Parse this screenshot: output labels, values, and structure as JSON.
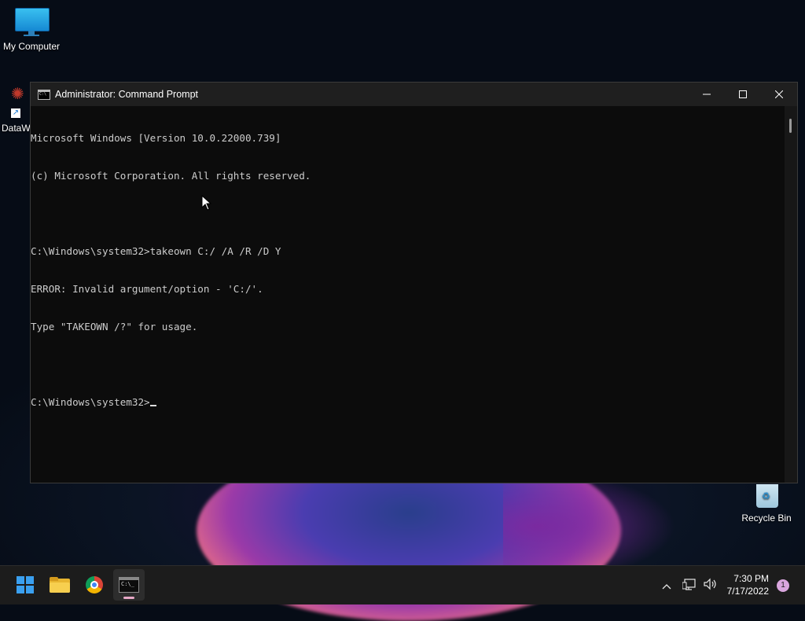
{
  "desktop": {
    "icons": [
      {
        "label": "My Computer"
      },
      {
        "label": "DataW"
      },
      {
        "label": "Recycle Bin"
      }
    ]
  },
  "window": {
    "title": "Administrator: Command Prompt",
    "controls": {
      "minimize": "─",
      "maximize": "☐",
      "close": "✕"
    },
    "lines": [
      "Microsoft Windows [Version 10.0.22000.739]",
      "(c) Microsoft Corporation. All rights reserved.",
      "",
      "C:\\Windows\\system32>takeown C:/ /A /R /D Y",
      "ERROR: Invalid argument/option - 'C:/'.",
      "Type \"TAKEOWN /?\" for usage.",
      "",
      "C:\\Windows\\system32>"
    ]
  },
  "taskbar": {
    "items": [
      "start-icon",
      "file-explorer-icon",
      "chrome-icon",
      "command-prompt-icon"
    ],
    "tray": {
      "overflow": "^",
      "time": "7:30 PM",
      "date": "7/17/2022",
      "notifications": "1"
    }
  }
}
